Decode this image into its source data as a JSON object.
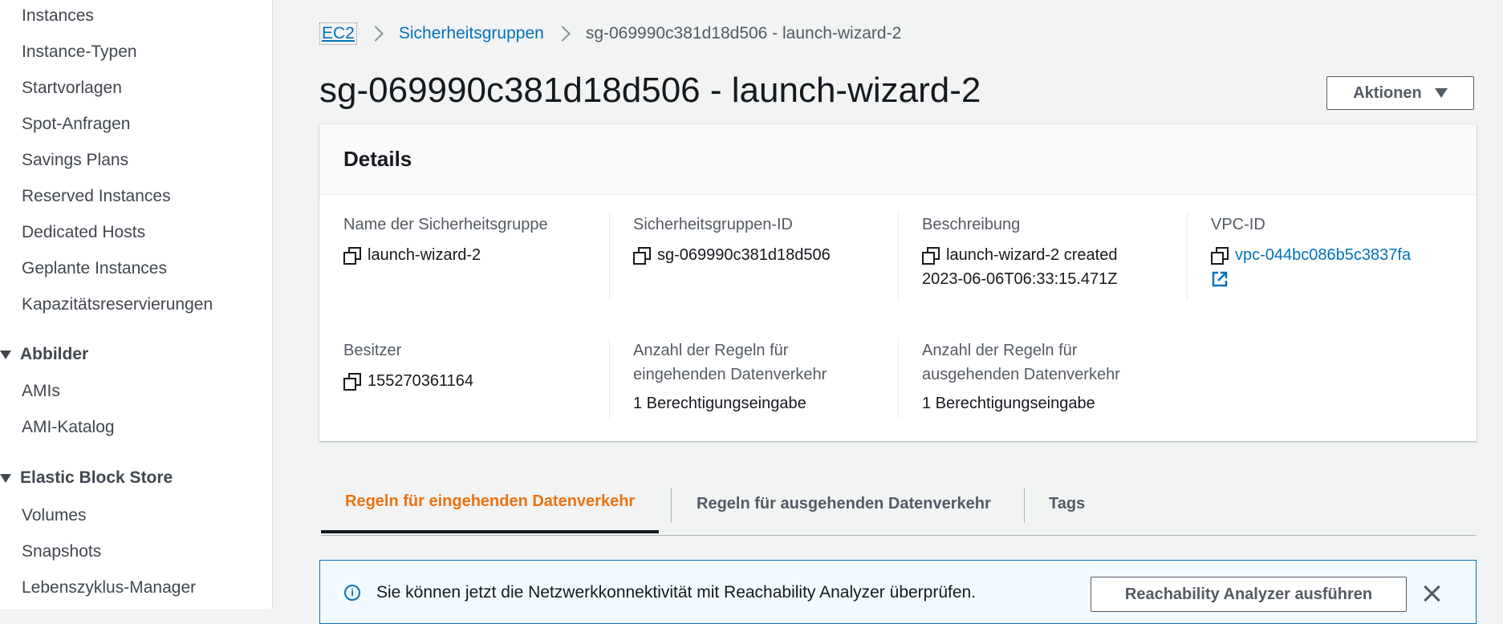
{
  "sidebar": {
    "items_top": [
      "Instances",
      "Instance-Typen",
      "Startvorlagen",
      "Spot-Anfragen",
      "Savings Plans",
      "Reserved Instances",
      "Dedicated Hosts",
      "Geplante Instances",
      "Kapazitätsreservierungen"
    ],
    "section_images": "Abbilder",
    "items_images": [
      "AMIs",
      "AMI-Katalog"
    ],
    "section_ebs": "Elastic Block Store",
    "items_ebs": [
      "Volumes",
      "Snapshots",
      "Lebenszyklus-Manager"
    ]
  },
  "breadcrumb": {
    "root": "EC2",
    "parent": "Sicherheitsgruppen",
    "current": "sg-069990c381d18d506 - launch-wizard-2"
  },
  "page": {
    "title": "sg-069990c381d18d506 - launch-wizard-2",
    "actions_label": "Aktionen"
  },
  "details": {
    "heading": "Details",
    "name": {
      "label": "Name der Sicherheitsgruppe",
      "value": "launch-wizard-2"
    },
    "id": {
      "label": "Sicherheitsgruppen-ID",
      "value": "sg-069990c381d18d506"
    },
    "description": {
      "label": "Beschreibung",
      "value": "launch-wizard-2 created 2023-06-06T06:33:15.471Z"
    },
    "vpc": {
      "label": "VPC-ID",
      "value": "vpc-044bc086b5c3837fa"
    },
    "owner": {
      "label": "Besitzer",
      "value": "155270361164"
    },
    "inbound_count": {
      "label": "Anzahl der Regeln für eingehenden Datenverkehr",
      "value": "1 Berechtigungseingabe"
    },
    "outbound_count": {
      "label": "Anzahl der Regeln für ausgehenden Datenverkehr",
      "value": "1 Berechtigungseingabe"
    }
  },
  "tabs": {
    "inbound": "Regeln für eingehenden Datenverkehr",
    "outbound": "Regeln für ausgehenden Datenverkehr",
    "tags": "Tags"
  },
  "alert": {
    "text": "Sie können jetzt die Netzwerkkonnektivität mit Reachability Analyzer überprüfen.",
    "button": "Reachability Analyzer ausführen"
  },
  "colors": {
    "link": "#0073bb",
    "active_tab": "#ec7211",
    "text": "#16191f",
    "muted": "#545b64"
  }
}
